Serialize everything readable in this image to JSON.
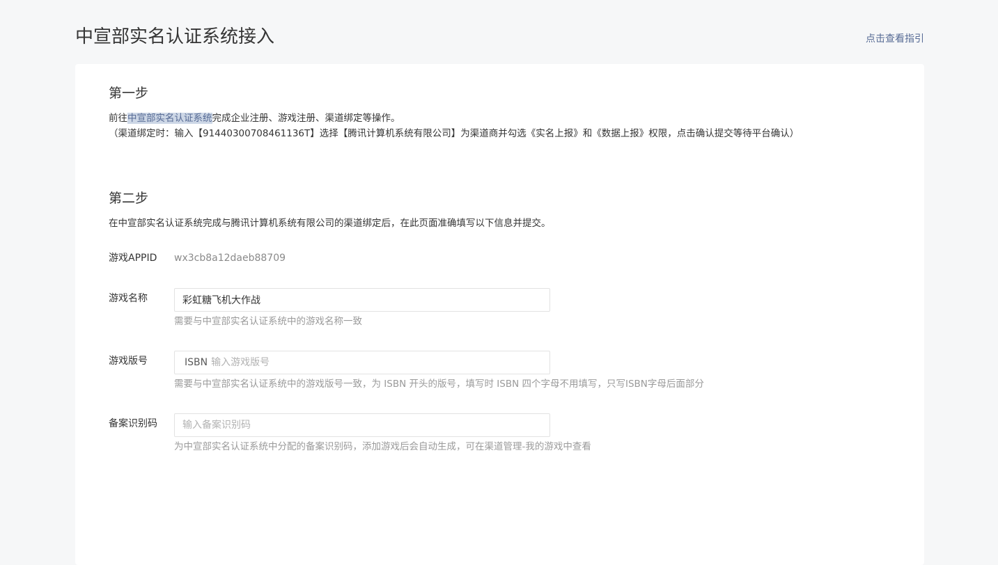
{
  "header": {
    "title": "中宣部实名认证系统接入",
    "guide_link": "点击查看指引"
  },
  "step1": {
    "title": "第一步",
    "line1_prefix": "前往",
    "line1_link": "中宣部实名认证系统",
    "line1_suffix": "完成企业注册、游戏注册、渠道绑定等操作。",
    "line2": "（渠道绑定时：输入【91440300708461136T】选择【腾讯计算机系统有限公司】为渠道商并勾选《实名上报》和《数据上报》权限，点击确认提交等待平台确认）"
  },
  "step2": {
    "title": "第二步",
    "desc": "在中宣部实名认证系统完成与腾讯计算机系统有限公司的渠道绑定后，在此页面准确填写以下信息并提交。"
  },
  "form": {
    "appid_label": "游戏APPID",
    "appid_value": "wx3cb8a12daeb88709",
    "name_label": "游戏名称",
    "name_value": "彩虹糖飞机大作战",
    "name_hint": "需要与中宣部实名认证系统中的游戏名称一致",
    "version_label": "游戏版号",
    "version_prefix": "ISBN",
    "version_placeholder": "输入游戏版号",
    "version_hint": "需要与中宣部实名认证系统中的游戏版号一致，为 ISBN 开头的版号，填写时 ISBN 四个字母不用填写，只写ISBN字母后面部分",
    "record_label": "备案识别码",
    "record_placeholder": "输入备案识别码",
    "record_hint": "为中宣部实名认证系统中分配的备案识别码，添加游戏后会自动生成，可在渠道管理-我的游戏中查看"
  }
}
